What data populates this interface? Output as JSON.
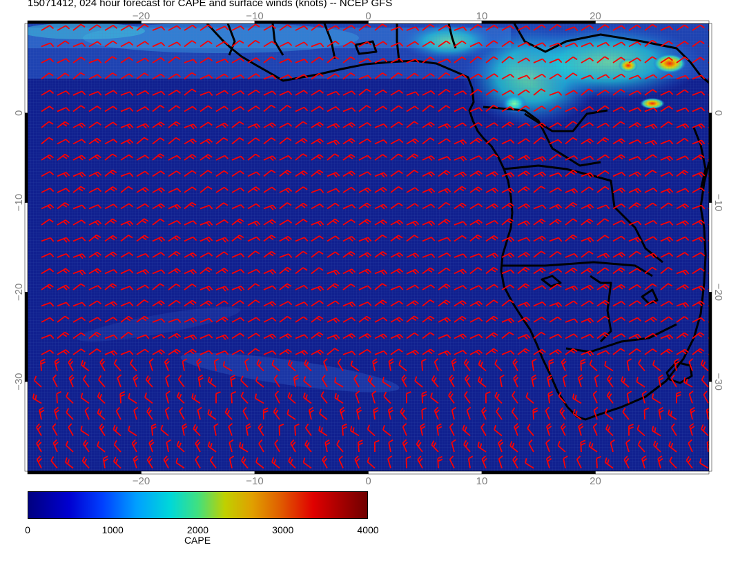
{
  "title": "15071412, 024 hour forecast for CAPE and surface winds (knots) -- NCEP GFS",
  "map": {
    "lon_range": [
      -30,
      30
    ],
    "lat_range": [
      -40,
      10
    ],
    "lon_ticks": [
      {
        "value": -20,
        "label": "−20"
      },
      {
        "value": -10,
        "label": "−10"
      },
      {
        "value": 0,
        "label": "0"
      },
      {
        "value": 10,
        "label": "10"
      },
      {
        "value": 20,
        "label": "20"
      }
    ],
    "lat_ticks": [
      {
        "value": 0,
        "label": "0"
      },
      {
        "value": -10,
        "label": "−10"
      },
      {
        "value": -20,
        "label": "−20"
      },
      {
        "value": -30,
        "label": "−30"
      }
    ],
    "ocean_color": "#10208f",
    "coast_color": "#000000",
    "barb_color": "#ff0000"
  },
  "colorbar": {
    "label": "CAPE",
    "ticks": [
      "0",
      "1000",
      "2000",
      "3000",
      "4000"
    ],
    "range": [
      0,
      4000
    ]
  }
}
